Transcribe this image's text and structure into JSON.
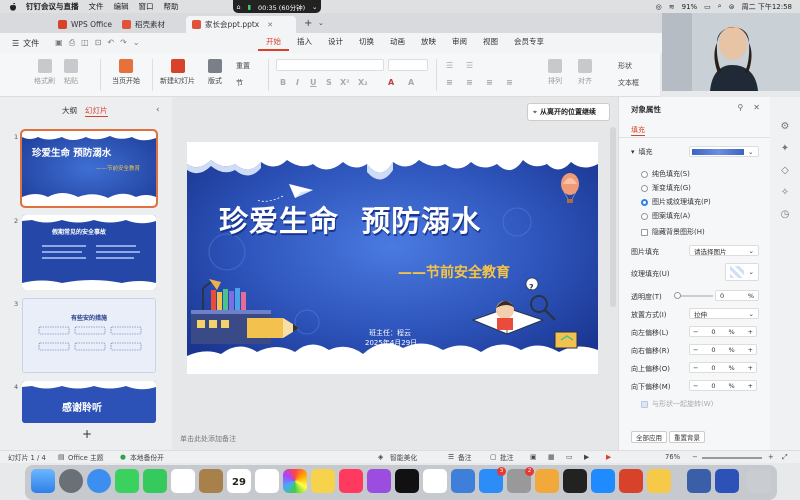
{
  "menubar": {
    "app_name": "钉钉会议与直播",
    "items": [
      "文件",
      "编辑",
      "窗口",
      "帮助"
    ],
    "recording": "00:35 (60分钟)",
    "battery": "91%",
    "datetime": "周二 下午12:58"
  },
  "tabs": [
    {
      "label": "WPS Office",
      "color": "#d9422a"
    },
    {
      "label": "稻壳素材",
      "color": "#e0533b"
    },
    {
      "label": "家长会ppt.pptx",
      "color": "#e0533b"
    }
  ],
  "menu": {
    "file": "文件",
    "tabs": [
      "开始",
      "插入",
      "设计",
      "切换",
      "动画",
      "放映",
      "审阅",
      "视图",
      "会员专享"
    ]
  },
  "ribbon": {
    "format_brush": "格式刷",
    "paste": "粘贴",
    "from_current": "当页开始",
    "new_slide": "新建幻灯片",
    "layout": "版式",
    "section": "节",
    "reset": "重置",
    "shape": "形状",
    "textbox": "文本框",
    "arrange": "排列",
    "align": "对齐"
  },
  "left_panel": {
    "tab_outline": "大纲",
    "tab_slides": "幻灯片",
    "slides": [
      {
        "num": "1",
        "title": "珍爱生命 预防溺水",
        "sub": "——节前安全教育"
      },
      {
        "num": "2",
        "title": "假期常见的安全事故"
      },
      {
        "num": "3",
        "title": "有些安的措施"
      },
      {
        "num": "4",
        "title": "感谢聆听"
      }
    ],
    "add": "+"
  },
  "canvas": {
    "location_btn": "从离开的位置继续",
    "slide_title": "珍爱生命  预防溺水",
    "slide_subtitle": "——节前安全教育",
    "teacher": "班主任：程云",
    "date": "2025年4月29日",
    "notes_placeholder": "单击此处添加备注"
  },
  "right_panel": {
    "title": "对象属性",
    "fill_tab": "填充",
    "fill_label": "填充",
    "options": [
      "纯色填充(S)",
      "渐变填充(G)",
      "图片或纹理填充(P)",
      "图案填充(A)"
    ],
    "hide_bg": "隐藏背景图形(H)",
    "pic_fill_label": "图片填充",
    "pic_fill_value": "请选择图片",
    "texture_label": "纹理填充(U)",
    "transparency_label": "透明度(T)",
    "transparency_value": "0",
    "transparency_unit": "%",
    "placement_label": "放置方式(I)",
    "placement_value": "拉伸",
    "offsets": [
      {
        "label": "向左偏移(L)",
        "value": "0",
        "unit": "%"
      },
      {
        "label": "向右偏移(R)",
        "value": "0",
        "unit": "%"
      },
      {
        "label": "向上偏移(O)",
        "value": "0",
        "unit": "%"
      },
      {
        "label": "向下偏移(M)",
        "value": "0",
        "unit": "%"
      }
    ],
    "rotate_with_shape": "与形状一起旋转(W)",
    "apply_all": "全部应用",
    "reset_bg": "重置背景"
  },
  "statusbar": {
    "slide_count": "幻灯片 1 / 4",
    "theme": "Office 主题",
    "backup": "本地备份开",
    "beautify": "智能美化",
    "notes": "备注",
    "comments": "批注",
    "zoom": "76%"
  },
  "colors": {
    "accent": "#d9422a",
    "slide_blue": "#2c52b8",
    "slide_dark_blue": "#1d3c98",
    "subtitle_yellow": "#f6c544"
  },
  "dock": {
    "badges": [
      {
        "icon": "app-store",
        "count": "3"
      },
      {
        "icon": "messages",
        "count": "2"
      }
    ],
    "calendar_day": "29"
  }
}
